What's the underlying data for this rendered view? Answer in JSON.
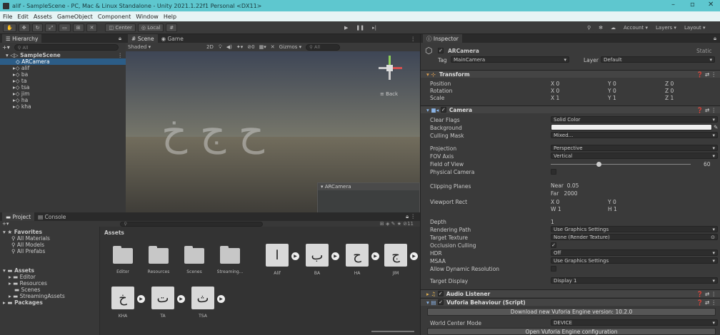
{
  "window": {
    "title": "alif - SampleScene - PC, Mac & Linux Standalone - Unity 2021.1.22f1 Personal <DX11>"
  },
  "menu": [
    "File",
    "Edit",
    "Assets",
    "GameObject",
    "Component",
    "Window",
    "Help"
  ],
  "toolbar": {
    "pivot": "Center",
    "space": "Local",
    "account": "Account",
    "layers": "Layers",
    "layout": "Layout"
  },
  "hierarchy": {
    "tab": "Hierarchy",
    "search": "All",
    "scene": "SampleScene",
    "items": [
      "ARCamera",
      "alif",
      "ba",
      "ta",
      "tsa",
      "jim",
      "ha",
      "kha"
    ]
  },
  "scene": {
    "tab_scene": "Scene",
    "tab_game": "Game",
    "shading": "Shaded",
    "mode2d": "2D",
    "gizmos": "Gizmos",
    "search": "All",
    "back": "Back",
    "preview_title": "ARCamera"
  },
  "project": {
    "tab_project": "Project",
    "tab_console": "Console",
    "count": "11",
    "favorites": {
      "label": "Favorites",
      "items": [
        "All Materials",
        "All Models",
        "All Prefabs"
      ]
    },
    "assets_tree": {
      "label": "Assets",
      "items": [
        "Editor",
        "Resources",
        "Scenes",
        "StreamingAssets"
      ]
    },
    "packages": "Packages",
    "breadcrumb": "Assets",
    "folders": [
      "Editor",
      "Resources",
      "Scenes",
      "Streaming..."
    ],
    "textures": [
      {
        "name": "Alif",
        "glyph": "ا"
      },
      {
        "name": "BA",
        "glyph": "ب"
      },
      {
        "name": "HA",
        "glyph": "ح"
      },
      {
        "name": "JIM",
        "glyph": "ج"
      },
      {
        "name": "KHA",
        "glyph": "خ"
      },
      {
        "name": "TA",
        "glyph": "ت"
      },
      {
        "name": "TSA",
        "glyph": "ث"
      }
    ]
  },
  "inspector": {
    "tab": "Inspector",
    "object_name": "ARCamera",
    "static": "Static",
    "tag_label": "Tag",
    "tag": "MainCamera",
    "layer_label": "Layer",
    "layer": "Default",
    "transform": {
      "title": "Transform",
      "rows": [
        {
          "label": "Position",
          "x": "0",
          "y": "0",
          "z": "0"
        },
        {
          "label": "Rotation",
          "x": "0",
          "y": "0",
          "z": "0"
        },
        {
          "label": "Scale",
          "x": "1",
          "y": "1",
          "z": "1"
        }
      ]
    },
    "camera": {
      "title": "Camera",
      "clear_flags_label": "Clear Flags",
      "clear_flags": "Solid Color",
      "background_label": "Background",
      "culling_mask_label": "Culling Mask",
      "culling_mask": "Mixed...",
      "projection_label": "Projection",
      "projection": "Perspective",
      "fov_axis_label": "FOV Axis",
      "fov_axis": "Vertical",
      "fov_label": "Field of View",
      "fov": "60",
      "physical_label": "Physical Camera",
      "clipping_label": "Clipping Planes",
      "near_label": "Near",
      "near": "0.05",
      "far_label": "Far",
      "far": "2000",
      "viewport_label": "Viewport Rect",
      "vx": "0",
      "vy": "0",
      "vw": "1",
      "vh": "1",
      "depth_label": "Depth",
      "depth": "1",
      "rendering_label": "Rendering Path",
      "rendering": "Use Graphics Settings",
      "target_texture_label": "Target Texture",
      "target_texture": "None (Render Texture)",
      "occlusion_label": "Occlusion Culling",
      "hdr_label": "HDR",
      "hdr": "Off",
      "msaa_label": "MSAA",
      "msaa": "Use Graphics Settings",
      "dynres_label": "Allow Dynamic Resolution",
      "target_display_label": "Target Display",
      "target_display": "Display 1"
    },
    "audio_listener": "Audio Listener",
    "vuforia": {
      "title": "Vuforia Behaviour (Script)",
      "download": "Download new Vuforia Engine version: 10.2.0",
      "world_center_label": "World Center Mode",
      "world_center": "DEVICE",
      "open_config": "Open Vuforia Engine configuration"
    }
  },
  "colors": {
    "accent": "#2c5d87",
    "titlebar": "#5ec7cf"
  }
}
